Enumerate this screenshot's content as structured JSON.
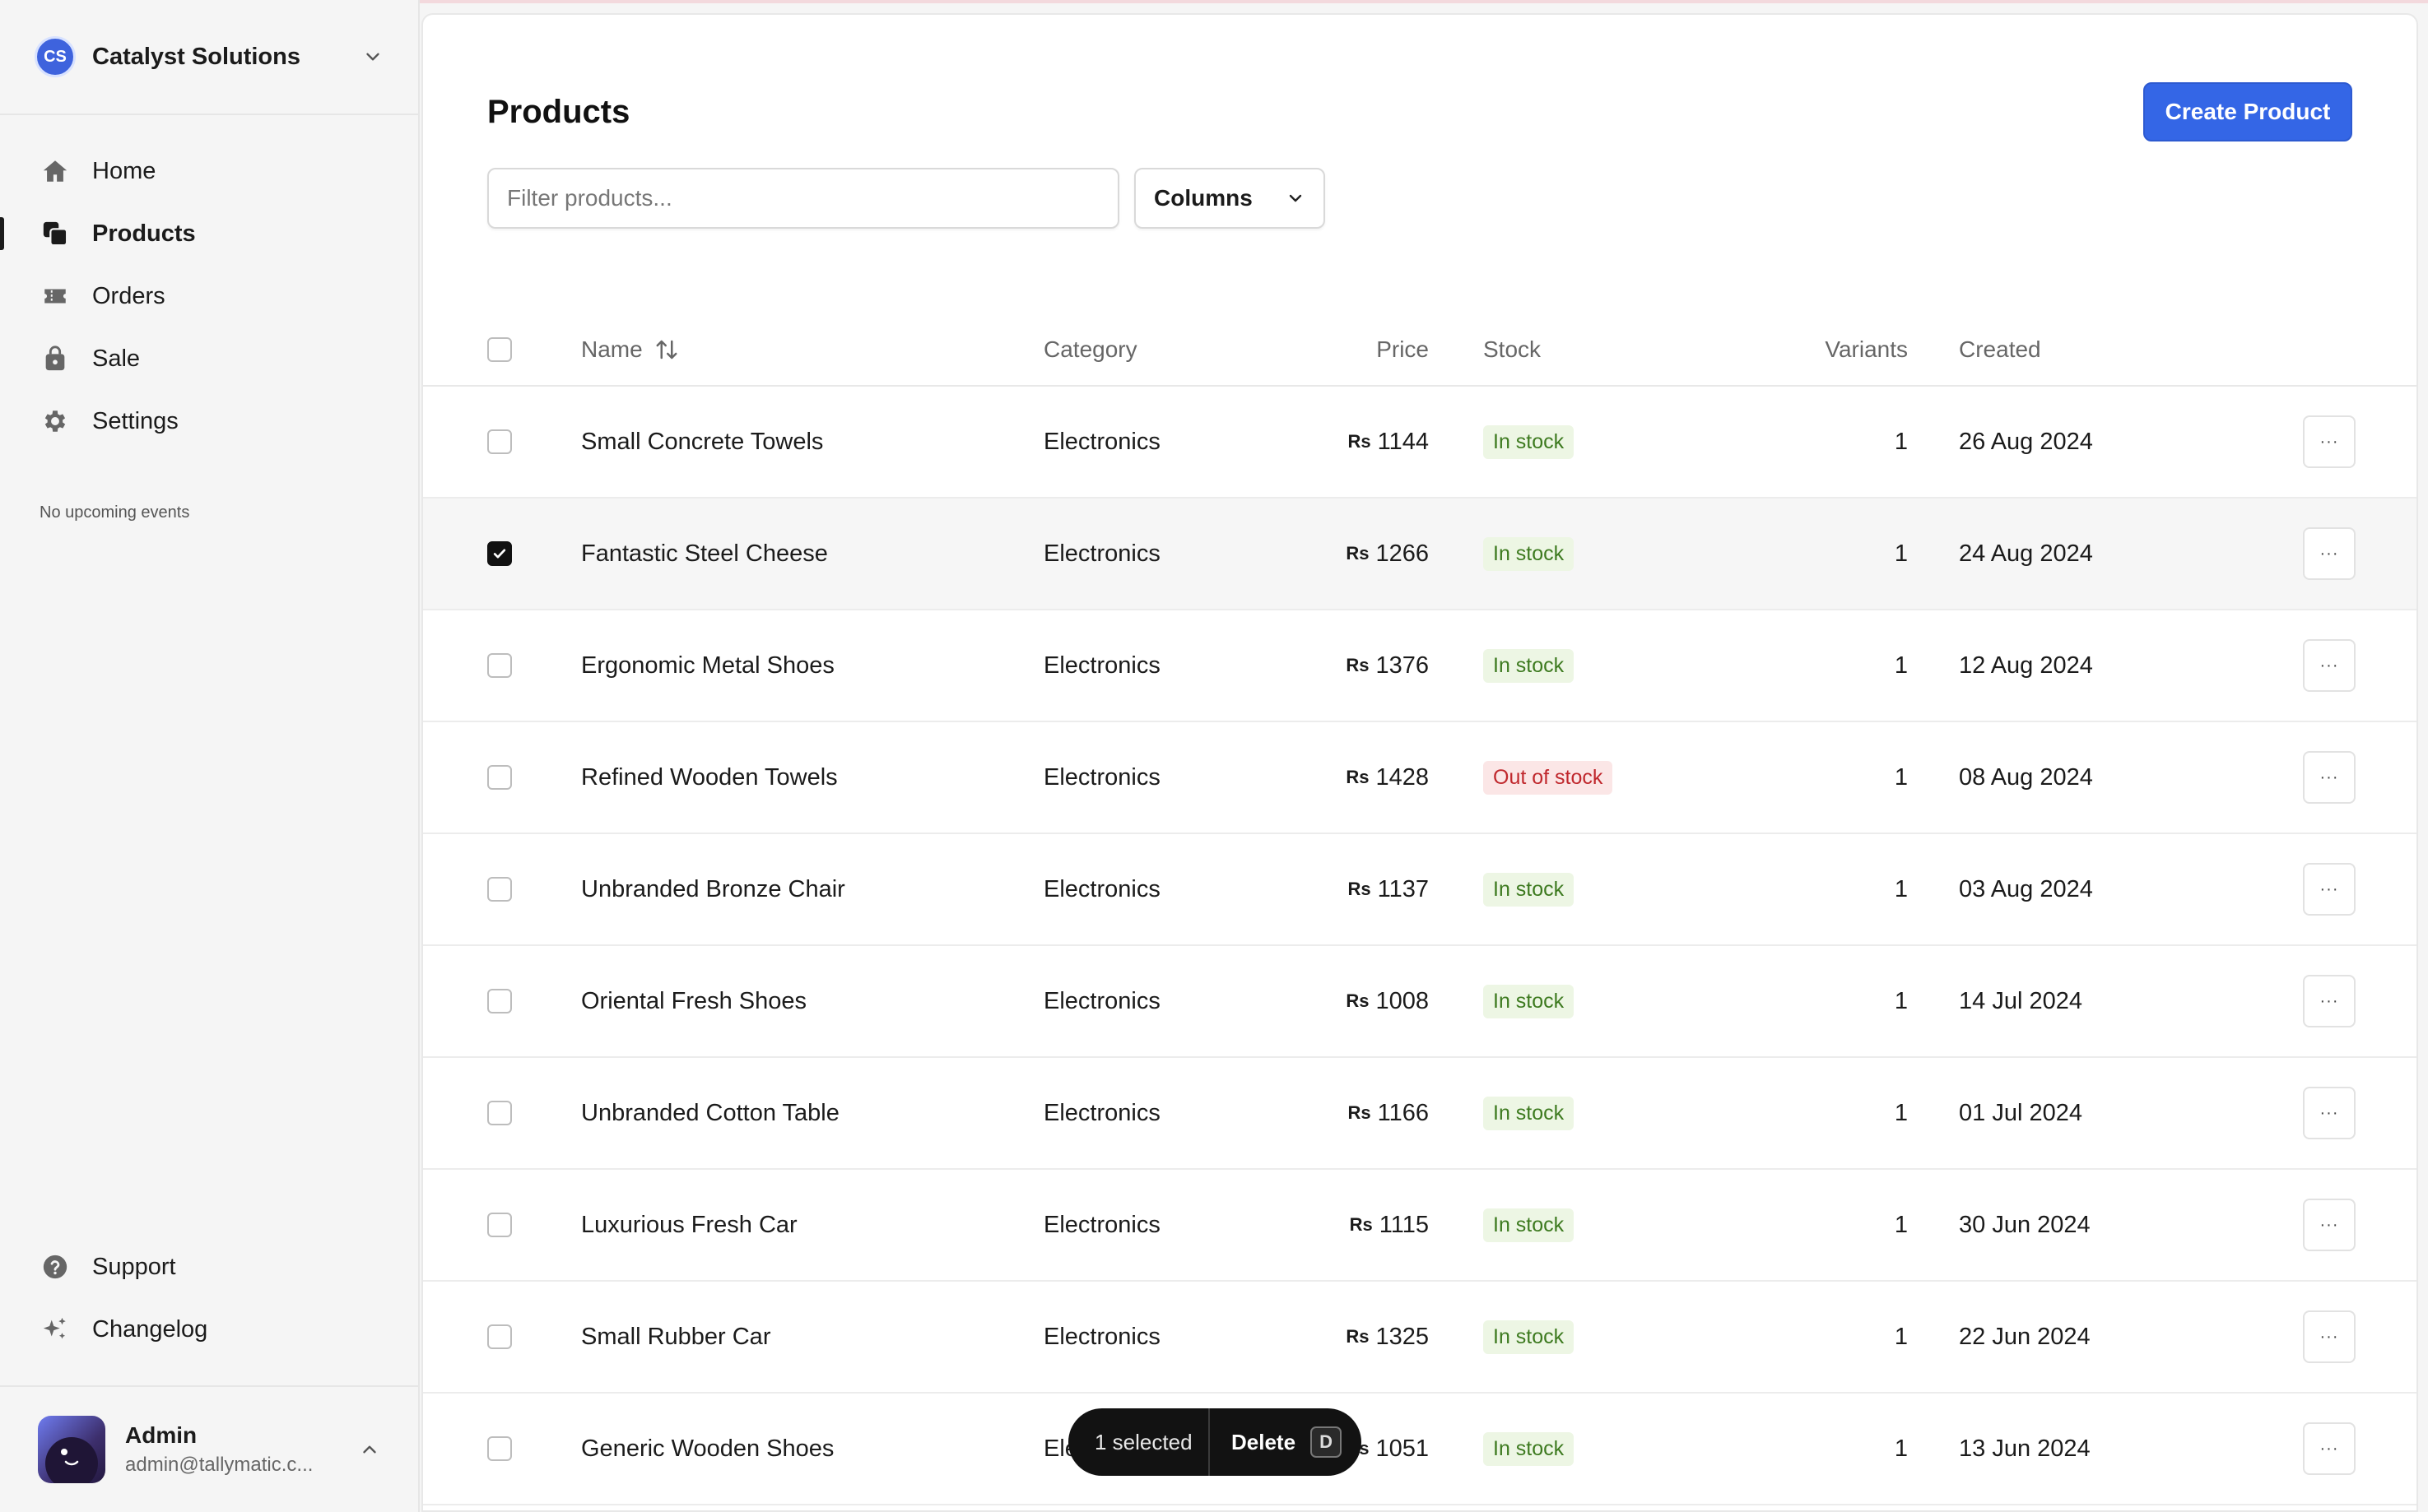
{
  "org": {
    "initials": "CS",
    "name": "Catalyst Solutions"
  },
  "nav": [
    {
      "label": "Home",
      "icon": "home-icon",
      "active": false
    },
    {
      "label": "Products",
      "icon": "products-icon",
      "active": true
    },
    {
      "label": "Orders",
      "icon": "orders-icon",
      "active": false
    },
    {
      "label": "Sale",
      "icon": "sale-icon",
      "active": false
    },
    {
      "label": "Settings",
      "icon": "gear-icon",
      "active": false
    }
  ],
  "events_text": "No upcoming events",
  "nav_bottom": [
    {
      "label": "Support",
      "icon": "help-icon"
    },
    {
      "label": "Changelog",
      "icon": "sparkle-icon"
    }
  ],
  "user": {
    "name": "Admin",
    "email": "admin@tallymatic.c..."
  },
  "page": {
    "title": "Products",
    "create_label": "Create Product",
    "filter_placeholder": "Filter products...",
    "columns_label": "Columns"
  },
  "table": {
    "headers": {
      "name": "Name",
      "category": "Category",
      "price": "Price",
      "stock": "Stock",
      "variants": "Variants",
      "created": "Created"
    },
    "currency": "Rs",
    "rows": [
      {
        "name": "Small Concrete Towels",
        "category": "Electronics",
        "price": "1144",
        "stock": "In stock",
        "variants": "1",
        "created": "26 Aug 2024",
        "selected": false
      },
      {
        "name": "Fantastic Steel Cheese",
        "category": "Electronics",
        "price": "1266",
        "stock": "In stock",
        "variants": "1",
        "created": "24 Aug 2024",
        "selected": true
      },
      {
        "name": "Ergonomic Metal Shoes",
        "category": "Electronics",
        "price": "1376",
        "stock": "In stock",
        "variants": "1",
        "created": "12 Aug 2024",
        "selected": false
      },
      {
        "name": "Refined Wooden Towels",
        "category": "Electronics",
        "price": "1428",
        "stock": "Out of stock",
        "variants": "1",
        "created": "08 Aug 2024",
        "selected": false
      },
      {
        "name": "Unbranded Bronze Chair",
        "category": "Electronics",
        "price": "1137",
        "stock": "In stock",
        "variants": "1",
        "created": "03 Aug 2024",
        "selected": false
      },
      {
        "name": "Oriental Fresh Shoes",
        "category": "Electronics",
        "price": "1008",
        "stock": "In stock",
        "variants": "1",
        "created": "14 Jul 2024",
        "selected": false
      },
      {
        "name": "Unbranded Cotton Table",
        "category": "Electronics",
        "price": "1166",
        "stock": "In stock",
        "variants": "1",
        "created": "01 Jul 2024",
        "selected": false
      },
      {
        "name": "Luxurious Fresh Car",
        "category": "Electronics",
        "price": "1115",
        "stock": "In stock",
        "variants": "1",
        "created": "30 Jun 2024",
        "selected": false
      },
      {
        "name": "Small Rubber Car",
        "category": "Electronics",
        "price": "1325",
        "stock": "In stock",
        "variants": "1",
        "created": "22 Jun 2024",
        "selected": false
      },
      {
        "name": "Generic Wooden Shoes",
        "category": "Electronics",
        "price": "1051",
        "stock": "In stock",
        "variants": "1",
        "created": "13 Jun 2024",
        "selected": false
      }
    ],
    "row_action_label": "···"
  },
  "selection_bar": {
    "count_label": "1 selected",
    "delete_label": "Delete",
    "shortcut": "D"
  },
  "colors": {
    "accent": "#3466e6",
    "in_stock_bg": "#edf6e4",
    "in_stock_text": "#3d7a1f",
    "out_stock_bg": "#fbe6e6",
    "out_stock_text": "#c0282d"
  }
}
